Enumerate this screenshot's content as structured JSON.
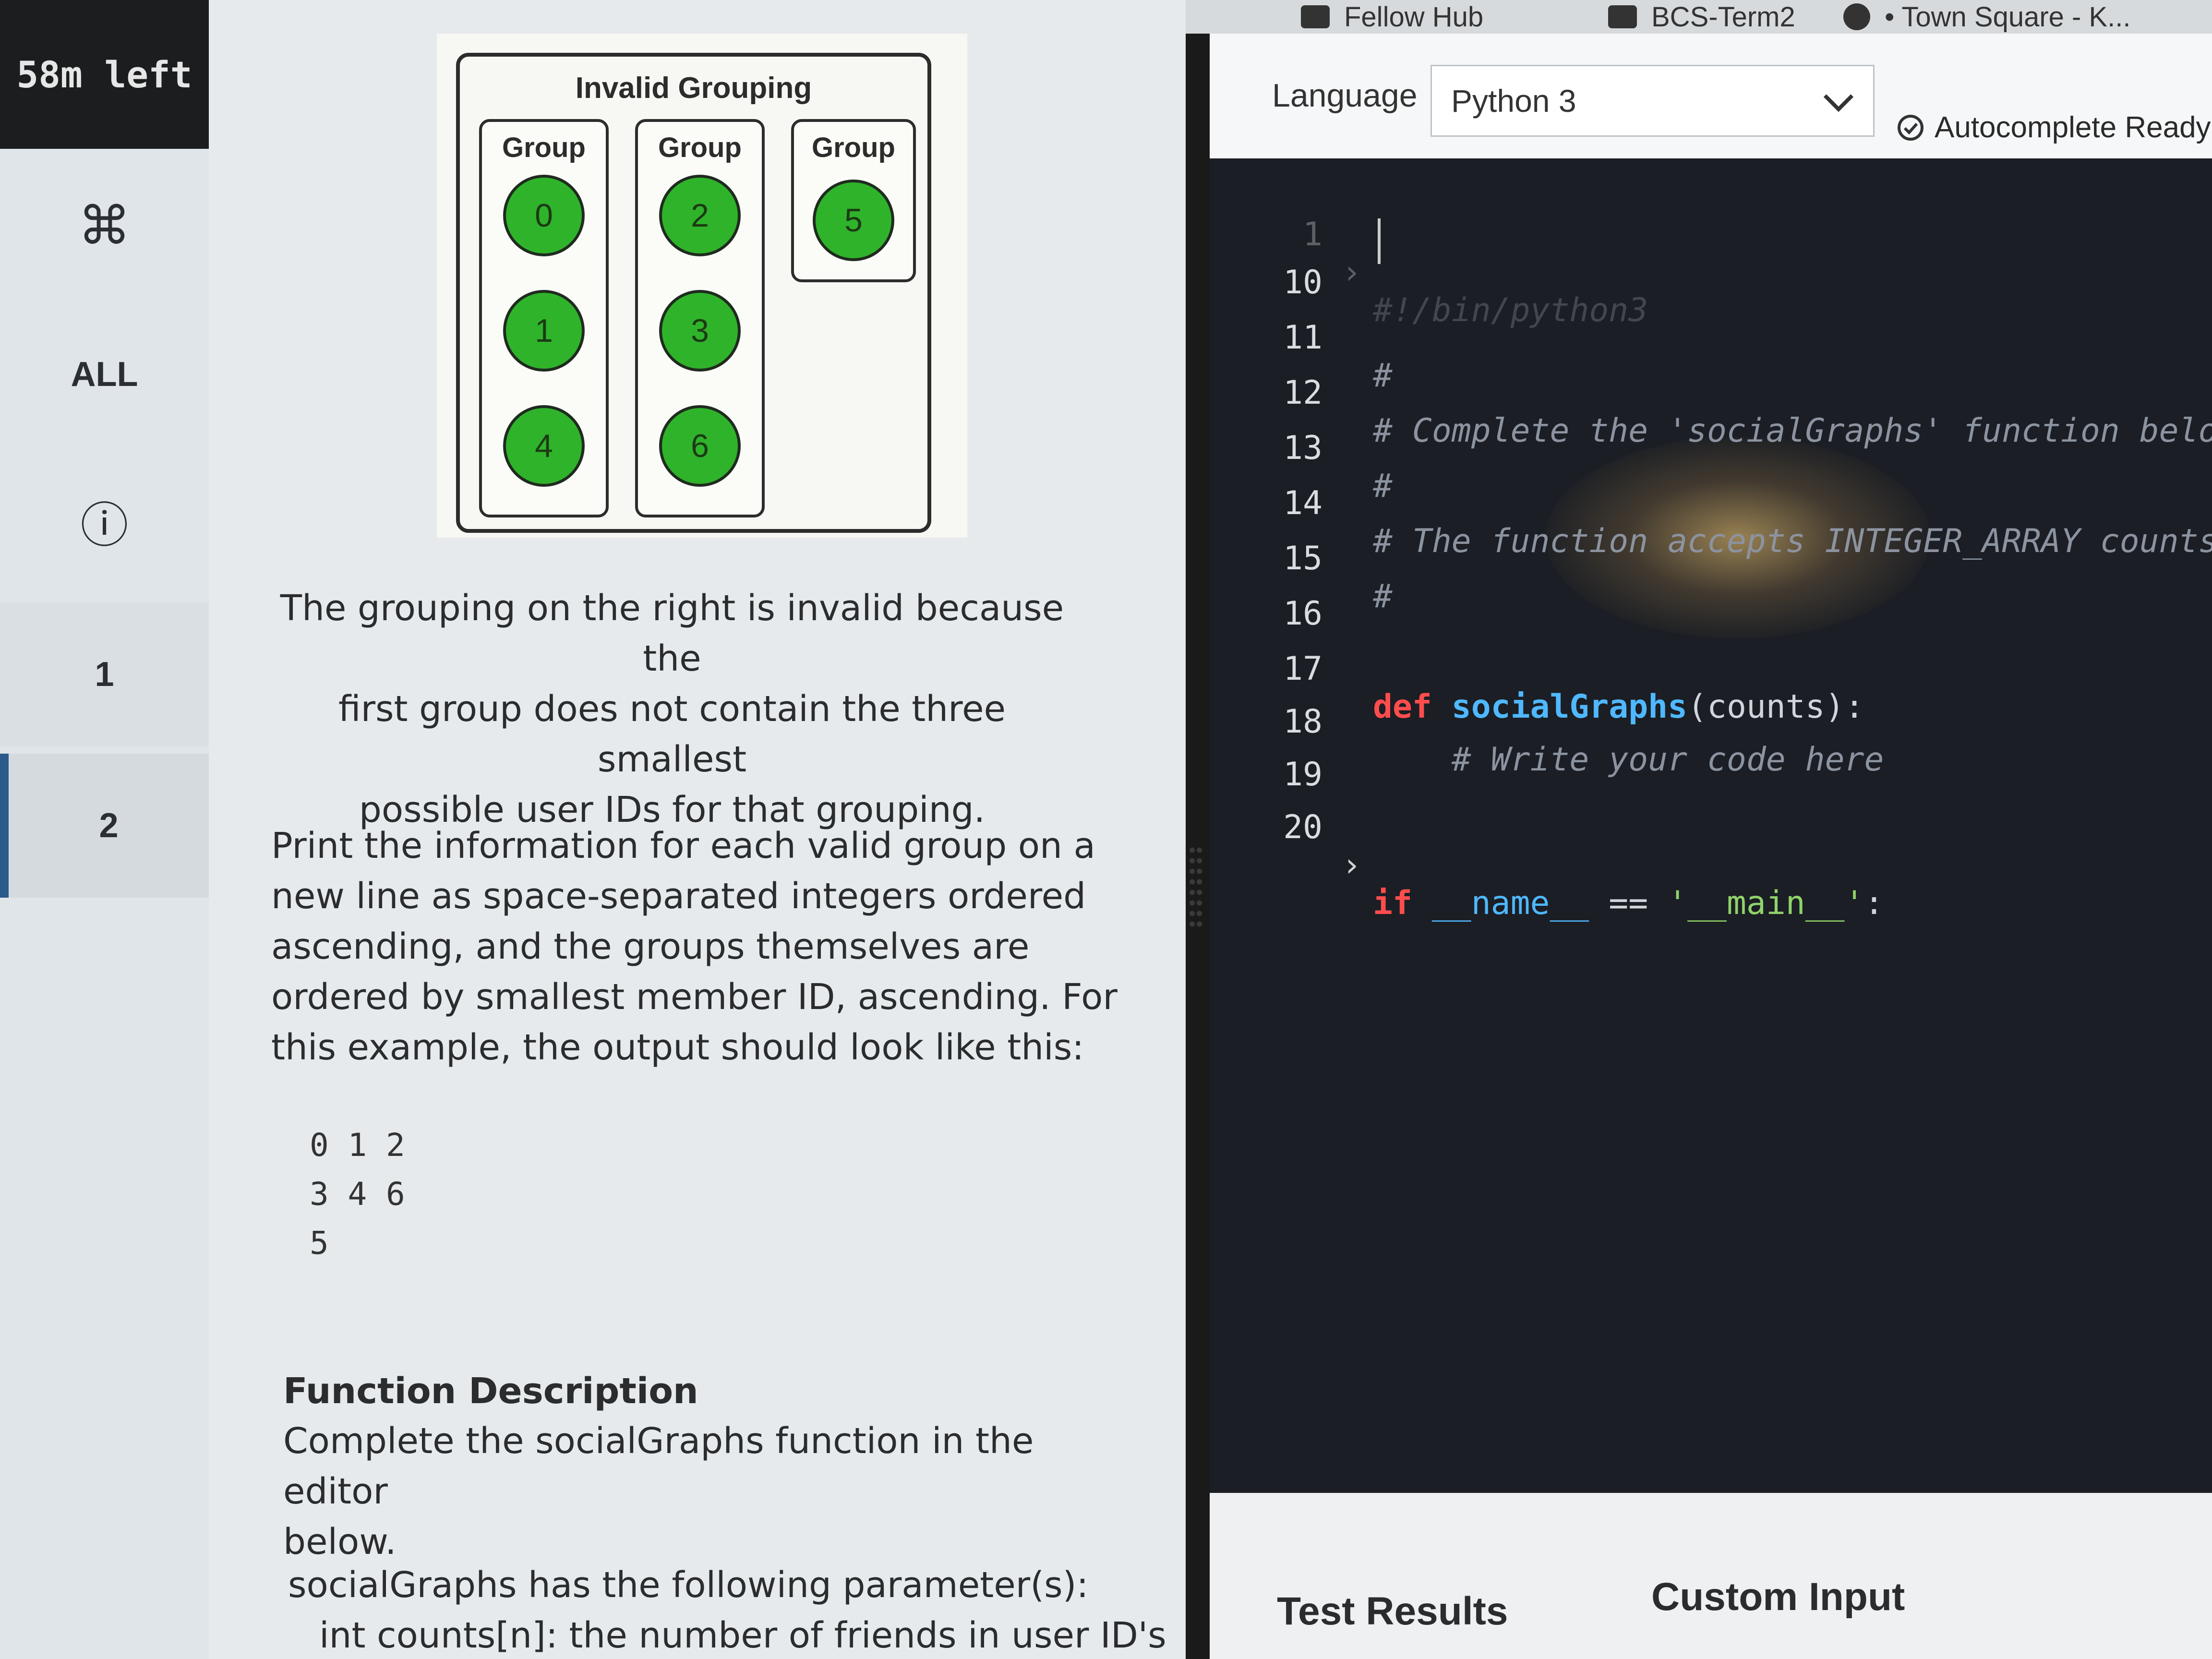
{
  "sidebar": {
    "timer": "58m left",
    "items": [
      {
        "label": "⌘",
        "icon": "command-icon"
      },
      {
        "label": "ALL"
      },
      {
        "label": "ⓘ",
        "icon": "info-icon"
      },
      {
        "label": "1"
      },
      {
        "label": "2"
      }
    ]
  },
  "figure": {
    "title": "Invalid Grouping",
    "groups": [
      {
        "label": "Group",
        "members": [
          "0",
          "1",
          "4"
        ]
      },
      {
        "label": "Group",
        "members": [
          "2",
          "3",
          "6"
        ]
      },
      {
        "label": "Group",
        "members": [
          "5"
        ]
      }
    ]
  },
  "problem": {
    "explanation_lines": [
      "The grouping on the right is invalid because the",
      "first group does not contain the three smallest",
      "possible user IDs for that grouping."
    ],
    "print_lines": [
      "Print the information for each valid group on a",
      "new line as space-separated integers ordered",
      "ascending, and the groups themselves are",
      "ordered by smallest member ID, ascending. For",
      "this example, the output should look like this:"
    ],
    "sample_output": "0 1 2\n3 4 6\n5",
    "function_description_title": "Function Description",
    "function_description_lines": [
      "Complete the socialGraphs function in the editor",
      "below."
    ],
    "parameters_line": "socialGraphs has the following parameter(s):",
    "param_counts": "int counts[n]: the number of friends in user ID's"
  },
  "topbar": {
    "tabs": [
      "Fellow Hub",
      "BCS-Term2",
      "• Town Square - K..."
    ]
  },
  "editor": {
    "language_label": "Language",
    "language_value": "Python 3",
    "autocomplete": "Autocomplete Ready",
    "lines": [
      {
        "num": "1",
        "text": "#!/bin/python3"
      },
      {
        "num": "10",
        "text": ""
      },
      {
        "num": "11",
        "text": "#"
      },
      {
        "num": "12",
        "text": "# Complete the 'socialGraphs' function below."
      },
      {
        "num": "13",
        "text": "#"
      },
      {
        "num": "14",
        "text": "# The function accepts INTEGER_ARRAY counts"
      },
      {
        "num": "15",
        "text": "#"
      },
      {
        "num": "16",
        "text": ""
      },
      {
        "num": "17",
        "kw": "def",
        "fn": "socialGraphs",
        "rest": "(counts):"
      },
      {
        "num": "18",
        "text": "    # Write your code here"
      },
      {
        "num": "19",
        "text": ""
      },
      {
        "num": "20",
        "kw": "if",
        "var": "__name__",
        "op": " == ",
        "str": "'__main__'",
        "tail": ":"
      }
    ]
  },
  "bottom": {
    "tabs": [
      "Test Results",
      "Custom Input"
    ]
  }
}
